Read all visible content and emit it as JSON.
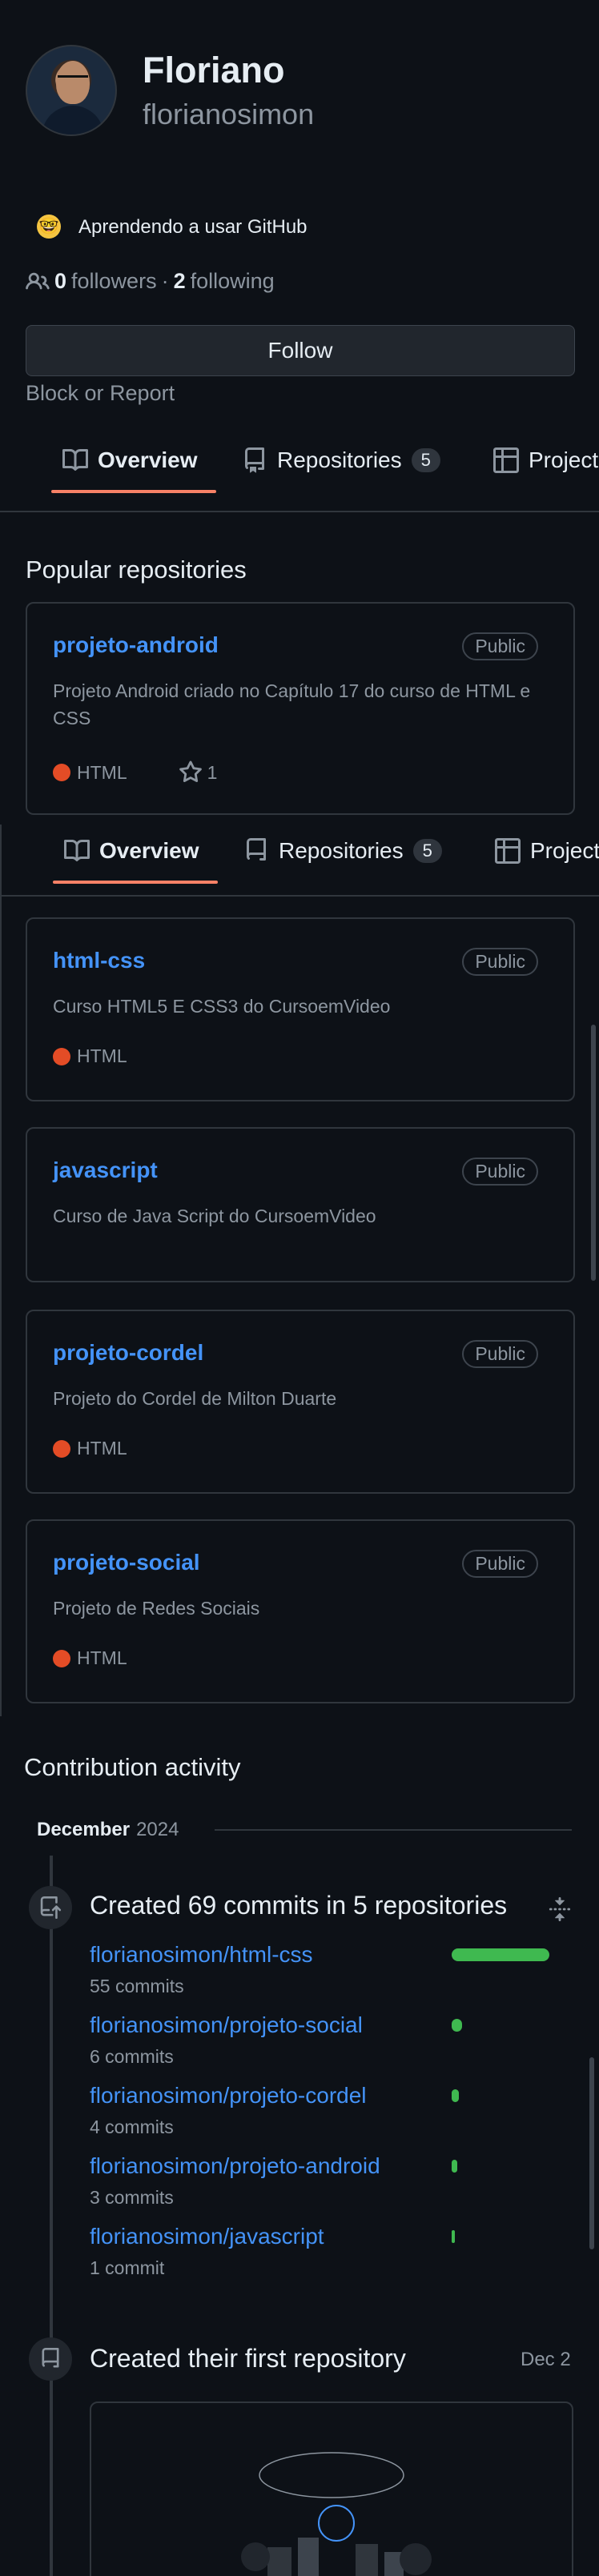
{
  "profile": {
    "name": "Floriano",
    "login": "florianosimon",
    "status_emoji": "🤓",
    "status_text": "Aprendendo a usar GitHub",
    "followers_count": "0",
    "followers_label": "followers",
    "separator": "·",
    "following_count": "2",
    "following_label": "following",
    "follow_button": "Follow",
    "block_report": "Block or Report"
  },
  "tabs": [
    {
      "label": "Overview",
      "icon": "book-icon"
    },
    {
      "label": "Repositories",
      "icon": "repo-icon",
      "count": "5"
    },
    {
      "label": "Projects",
      "icon": "table-icon"
    }
  ],
  "popular": {
    "title": "Popular repositories",
    "repos": [
      {
        "name": "projeto-android",
        "visibility": "Public",
        "description": "Projeto Android criado no Capítulo 17 do curso de HTML e CSS",
        "language": "HTML",
        "stars": "1"
      },
      {
        "name": "html-css",
        "visibility": "Public",
        "description": "Curso HTML5 E CSS3 do CursoemVideo",
        "language": "HTML"
      },
      {
        "name": "javascript",
        "visibility": "Public",
        "description": "Curso de Java Script do CursoemVideo",
        "language": ""
      },
      {
        "name": "projeto-cordel",
        "visibility": "Public",
        "description": "Projeto do Cordel de Milton Duarte",
        "language": "HTML"
      },
      {
        "name": "projeto-social",
        "visibility": "Public",
        "description": "Projeto de Redes Sociais",
        "language": "HTML"
      }
    ]
  },
  "activity": {
    "title": "Contribution activity",
    "month": "December",
    "year": "2024",
    "commits_title": "Created 69 commits in 5 repositories",
    "commits": [
      {
        "repo": "florianosimon/html-css",
        "count": "55 commits",
        "value": 55
      },
      {
        "repo": "florianosimon/projeto-social",
        "count": "6 commits",
        "value": 6
      },
      {
        "repo": "florianosimon/projeto-cordel",
        "count": "4 commits",
        "value": 4
      },
      {
        "repo": "florianosimon/projeto-android",
        "count": "3 commits",
        "value": 3
      },
      {
        "repo": "florianosimon/javascript",
        "count": "1 commit",
        "value": 1
      }
    ],
    "first_repo_title": "Created their first repository",
    "first_repo_date": "Dec 2"
  },
  "colors": {
    "accent": "#f78166",
    "link": "#4493f8",
    "html_lang": "#e34c26",
    "commit_bar": "#3fb950"
  }
}
